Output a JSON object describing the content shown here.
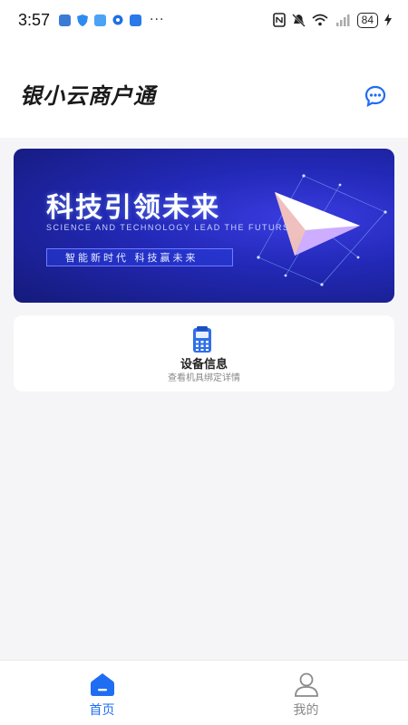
{
  "status_bar": {
    "time": "3:57",
    "overflow": "···",
    "battery": "84"
  },
  "header": {
    "title": "银小云商户通",
    "message_icon": "chat-bubble-icon"
  },
  "banner": {
    "title": "科技引领未来",
    "subtitle": "SCIENCE  AND  TECHNOLOGY  LEAD  THE FUTURS",
    "tagline": "智能新时代   科技赢未来"
  },
  "device_card": {
    "icon": "pos-terminal-icon",
    "title": "设备信息",
    "subtitle": "查看机具绑定详情"
  },
  "tabbar": {
    "items": [
      {
        "label": "首页",
        "icon": "home-icon",
        "active": true
      },
      {
        "label": "我的",
        "icon": "user-icon",
        "active": false
      }
    ]
  },
  "colors": {
    "accent": "#1f6df2",
    "background": "#f5f5f7",
    "banner_dark": "#151a7a"
  }
}
